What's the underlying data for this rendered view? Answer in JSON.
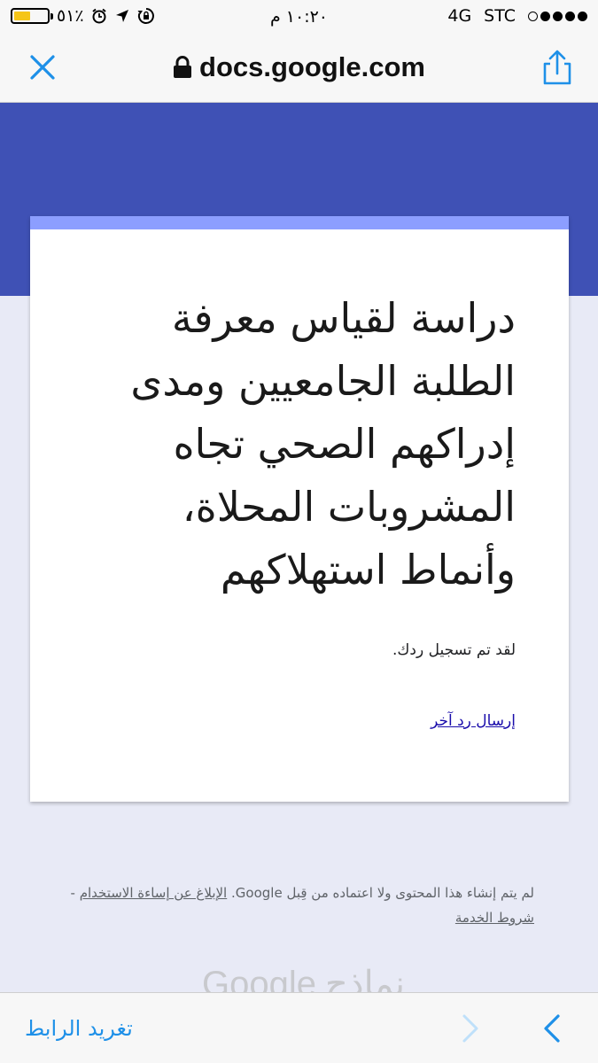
{
  "status_bar": {
    "carrier": "STC",
    "network": "4G",
    "time": "١٠:٢٠ م",
    "battery_text": "٥١٪",
    "battery_level": 0.51,
    "signal_bars_filled": 4,
    "signal_bars_total": 5,
    "icons": [
      "battery-icon",
      "alarm-icon",
      "location-arrow-icon",
      "rotation-lock-icon"
    ]
  },
  "browser": {
    "url": "docs.google.com",
    "accent_color": "#1e90e8",
    "icons": [
      "close-icon",
      "lock-icon",
      "share-icon"
    ]
  },
  "form": {
    "header_color": "#3f51b5",
    "accent_bar_color": "#8c9eff",
    "title": "دراسة لقياس معرفة الطلبة الجامعيين ومدى إدراكهم الصحي تجاه المشروبات المحلاة، وأنماط استهلاكهم",
    "confirmation": "لقد تم تسجيل ردك.",
    "another_response_link": "إرسال رد آخر"
  },
  "footer": {
    "disclaimer": "لم يتم إنشاء هذا المحتوى ولا اعتماده من قِبل Google.",
    "report_abuse_link": "الإبلاغ عن إساءة الاستخدام",
    "separator": "-",
    "terms_link": "شروط الخدمة",
    "logo_google": "Google",
    "logo_forms": "نماذج"
  },
  "bottom_toolbar": {
    "tweet_link_label": "تغريد الرابط",
    "icons": [
      "chevron-right-icon",
      "chevron-left-icon"
    ]
  }
}
